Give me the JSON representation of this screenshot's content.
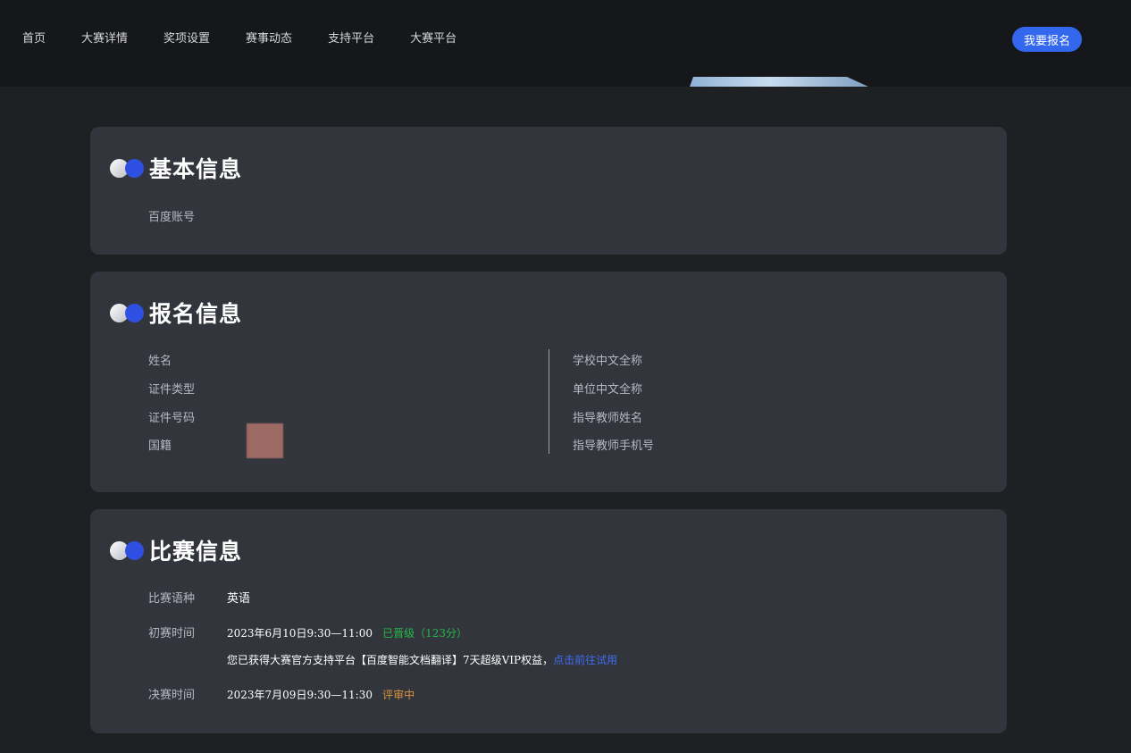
{
  "nav": {
    "items": [
      "首页",
      "大赛详情",
      "奖项设置",
      "赛事动态",
      "支持平台",
      "大赛平台"
    ],
    "signup_button": "我要报名"
  },
  "basic_info": {
    "title": "基本信息",
    "baidu_account_label": "百度账号"
  },
  "registration": {
    "title": "报名信息",
    "left_labels": [
      "姓名",
      "证件类型",
      "证件号码",
      "国籍"
    ],
    "right_labels": [
      "学校中文全称",
      "单位中文全称",
      "指导教师姓名",
      "指导教师手机号"
    ]
  },
  "contest": {
    "title": "比赛信息",
    "language_label": "比赛语种",
    "language_value": "英语",
    "prelim_label": "初赛时间",
    "prelim_time": "2023年6月10日9:30—11:00",
    "prelim_status": "已晋级（123分）",
    "vip_notice": "您已获得大赛官方支持平台【百度智能文档翻译】7天超级VIP权益，",
    "vip_link": "点击前往试用",
    "final_label": "决赛时间",
    "final_time": "2023年7月09日9:30—11:30",
    "final_status": "评审中"
  },
  "colors": {
    "accent": "#3267ee",
    "success": "#27b84a",
    "pending": "#d9953f",
    "card_bg": "#33353d",
    "page_bg": "#1f2024"
  }
}
